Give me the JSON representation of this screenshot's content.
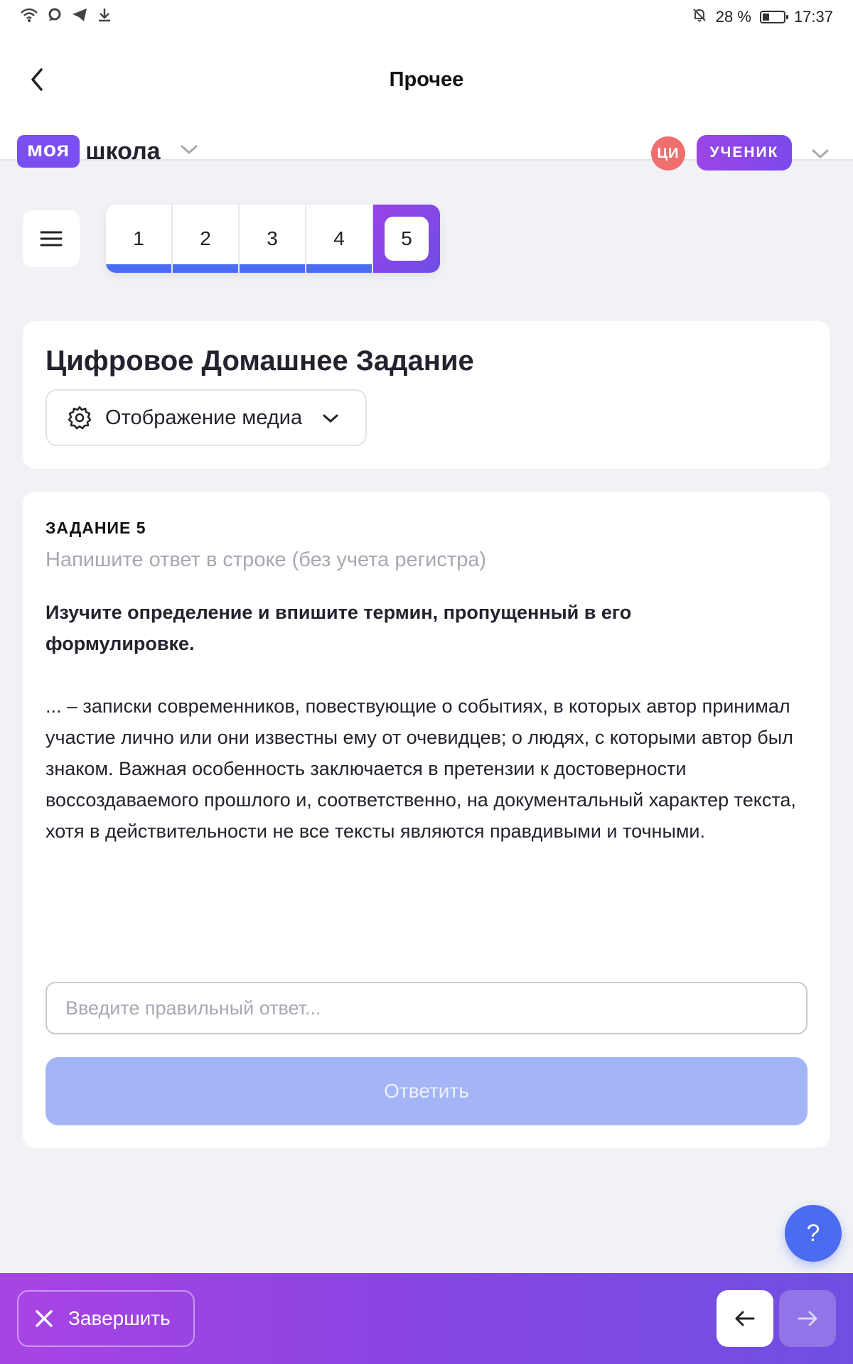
{
  "status_bar": {
    "battery": "28 %",
    "time": "17:37",
    "battery_level": 0.28,
    "left_icons": [
      "wifi-icon",
      "chat-icon",
      "telegram-icon",
      "download-icon"
    ],
    "right_icons": [
      "bell-off-icon",
      "battery-icon"
    ]
  },
  "header": {
    "title": "Прочее",
    "logo_part1": "моя",
    "logo_part2": "школа",
    "avatar_initials": "ЦИ",
    "role": "УЧЕНИК"
  },
  "task_nav": {
    "tabs": [
      "1",
      "2",
      "3",
      "4",
      "5"
    ],
    "active": "5"
  },
  "assignment": {
    "title": "Цифровое Домашнее Задание",
    "media_toggle": "Отображение медиа"
  },
  "task": {
    "label": "ЗАДАНИЕ 5",
    "hint": "Напишите ответ в строке (без учета регистра)",
    "question": "Изучите определение и впишите термин, пропущенный в его формулировке.",
    "text": "...  – записки современников, повествующие о событиях, в которых автор принимал участие лично или они известны ему от очевидцев; о людях, с которыми автор был знаком. Важная особенность заключается в претензии к достоверности воссоздаваемого прошлого и, соответственно, на документальный характер текста, хотя в действительности не все тексты являются правдивыми и точными.",
    "input_placeholder": "Введите правильный ответ...",
    "submit_label": "Ответить"
  },
  "help": {
    "label": "?"
  },
  "bottom_bar": {
    "finish_label": "Завершить"
  },
  "colors": {
    "brand": "#7a4ef3",
    "accent_blue": "#4b6cf0",
    "submit_disabled": "#a3b5f6",
    "avatar": "#f06e6e"
  }
}
